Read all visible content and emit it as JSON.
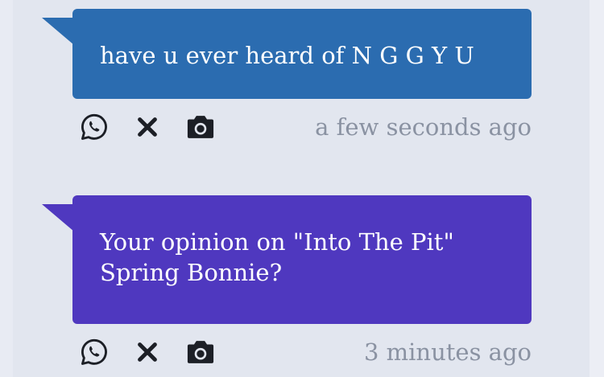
{
  "colors": {
    "page_bg": "#e8ebf3",
    "panel_bg": "#e2e6ef",
    "bubble_blue": "#2b6cb0",
    "bubble_purple": "#4f38bf",
    "icon": "#1c1f26",
    "time": "#8a92a2"
  },
  "messages": [
    {
      "text": "have u ever heard of N G G Y U",
      "color": "#2b6cb0",
      "time": "a few seconds ago",
      "actions": [
        "whatsapp-icon",
        "x-icon",
        "camera-icon"
      ]
    },
    {
      "text": "Your opinion on \"Into The Pit\" Spring Bonnie?",
      "line1": "Your opinion on \"Into The Pit\"",
      "line2": "Spring Bonnie?",
      "color": "#4f38bf",
      "time": "3 minutes ago",
      "actions": [
        "whatsapp-icon",
        "x-icon",
        "camera-icon"
      ]
    }
  ]
}
